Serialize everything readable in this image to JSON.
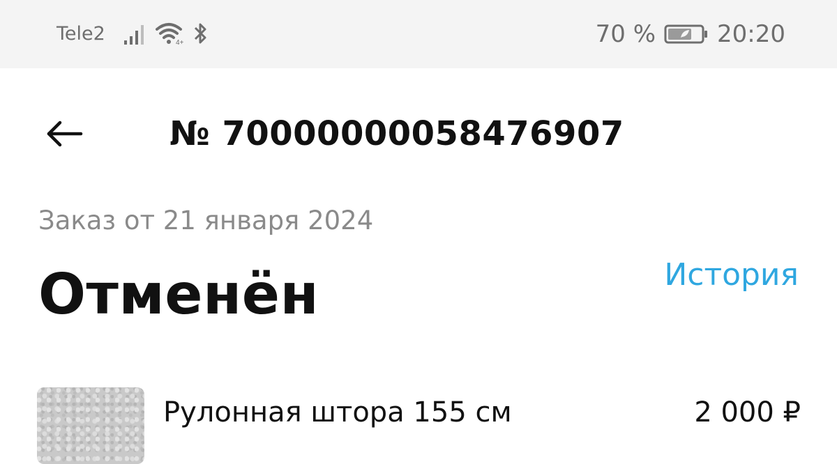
{
  "status_bar": {
    "carrier": "Tele2",
    "battery_percent": "70 %",
    "battery_level": 0.7,
    "time": "20:20",
    "icons": [
      "signal-icon",
      "wifi-icon",
      "bluetooth-icon",
      "battery-icon"
    ]
  },
  "header": {
    "back_icon": "back-arrow-icon",
    "order_number": "№ 70000000058476907"
  },
  "order": {
    "date": "Заказ от 21 января 2024",
    "status": "Отменён",
    "history_link": "История"
  },
  "items": [
    {
      "name": "Рулонная штора 155 см",
      "price": "2 000 ₽"
    }
  ],
  "colors": {
    "accent": "#2fa7e0",
    "status_bar_bg": "#f4f4f4",
    "secondary_text": "#8a8a8a",
    "primary_text": "#111111"
  }
}
